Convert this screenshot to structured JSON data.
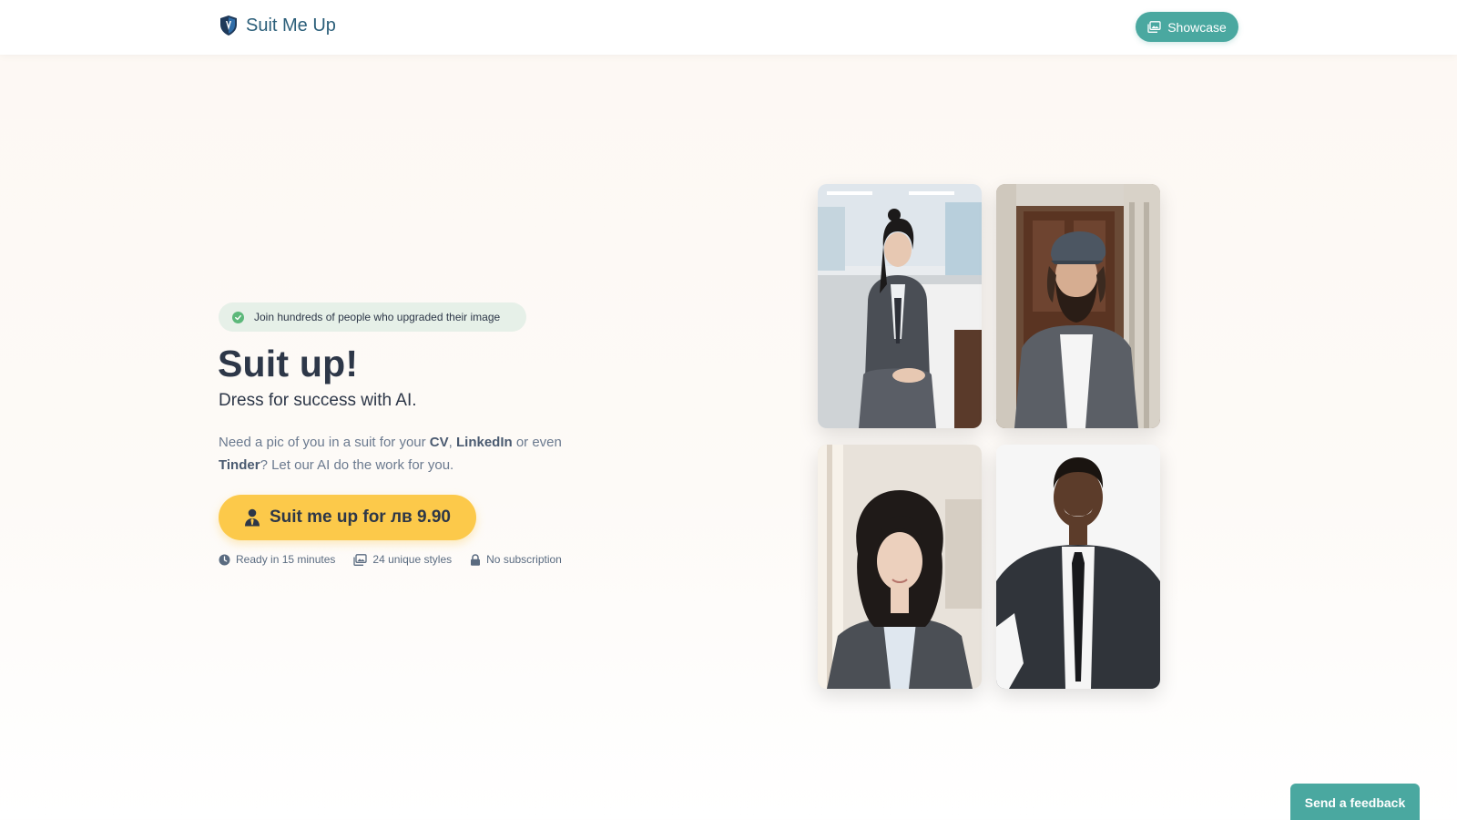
{
  "header": {
    "brand_name": "Suit Me Up",
    "brand_icon": "shield-logo-icon",
    "showcase_label": "Showcase",
    "showcase_icon": "images-icon"
  },
  "hero": {
    "badge_text": "Join hundreds of people who upgraded their image",
    "badge_icon": "check-circle-icon",
    "title": "Suit up!",
    "subtitle": "Dress for success with AI.",
    "description": {
      "part1": "Need a pic of you in a suit for your ",
      "cv": "CV",
      "part2": ", ",
      "linkedin": "LinkedIn",
      "part3": " or even ",
      "tinder": "Tinder",
      "part4": "? Let our AI do the work for you."
    },
    "cta_label": "Suit me up for лв 9.90",
    "cta_icon": "user-tie-icon"
  },
  "features": [
    {
      "icon": "clock-icon",
      "label": "Ready in 15 minutes"
    },
    {
      "icon": "images-icon",
      "label": "24 unique styles"
    },
    {
      "icon": "lock-icon",
      "label": "No subscription"
    }
  ],
  "gallery": [
    {
      "name": "woman-office-portrait"
    },
    {
      "name": "man-cap-beard-portrait"
    },
    {
      "name": "woman-curly-hair-portrait"
    },
    {
      "name": "man-smiling-tie-portrait"
    }
  ],
  "feedback_label": "Send a feedback",
  "colors": {
    "accent_teal": "#4aa8a0",
    "cta_yellow": "#fcc94a",
    "brand_blue": "#2c5f7a",
    "badge_green": "#5cb87a"
  }
}
